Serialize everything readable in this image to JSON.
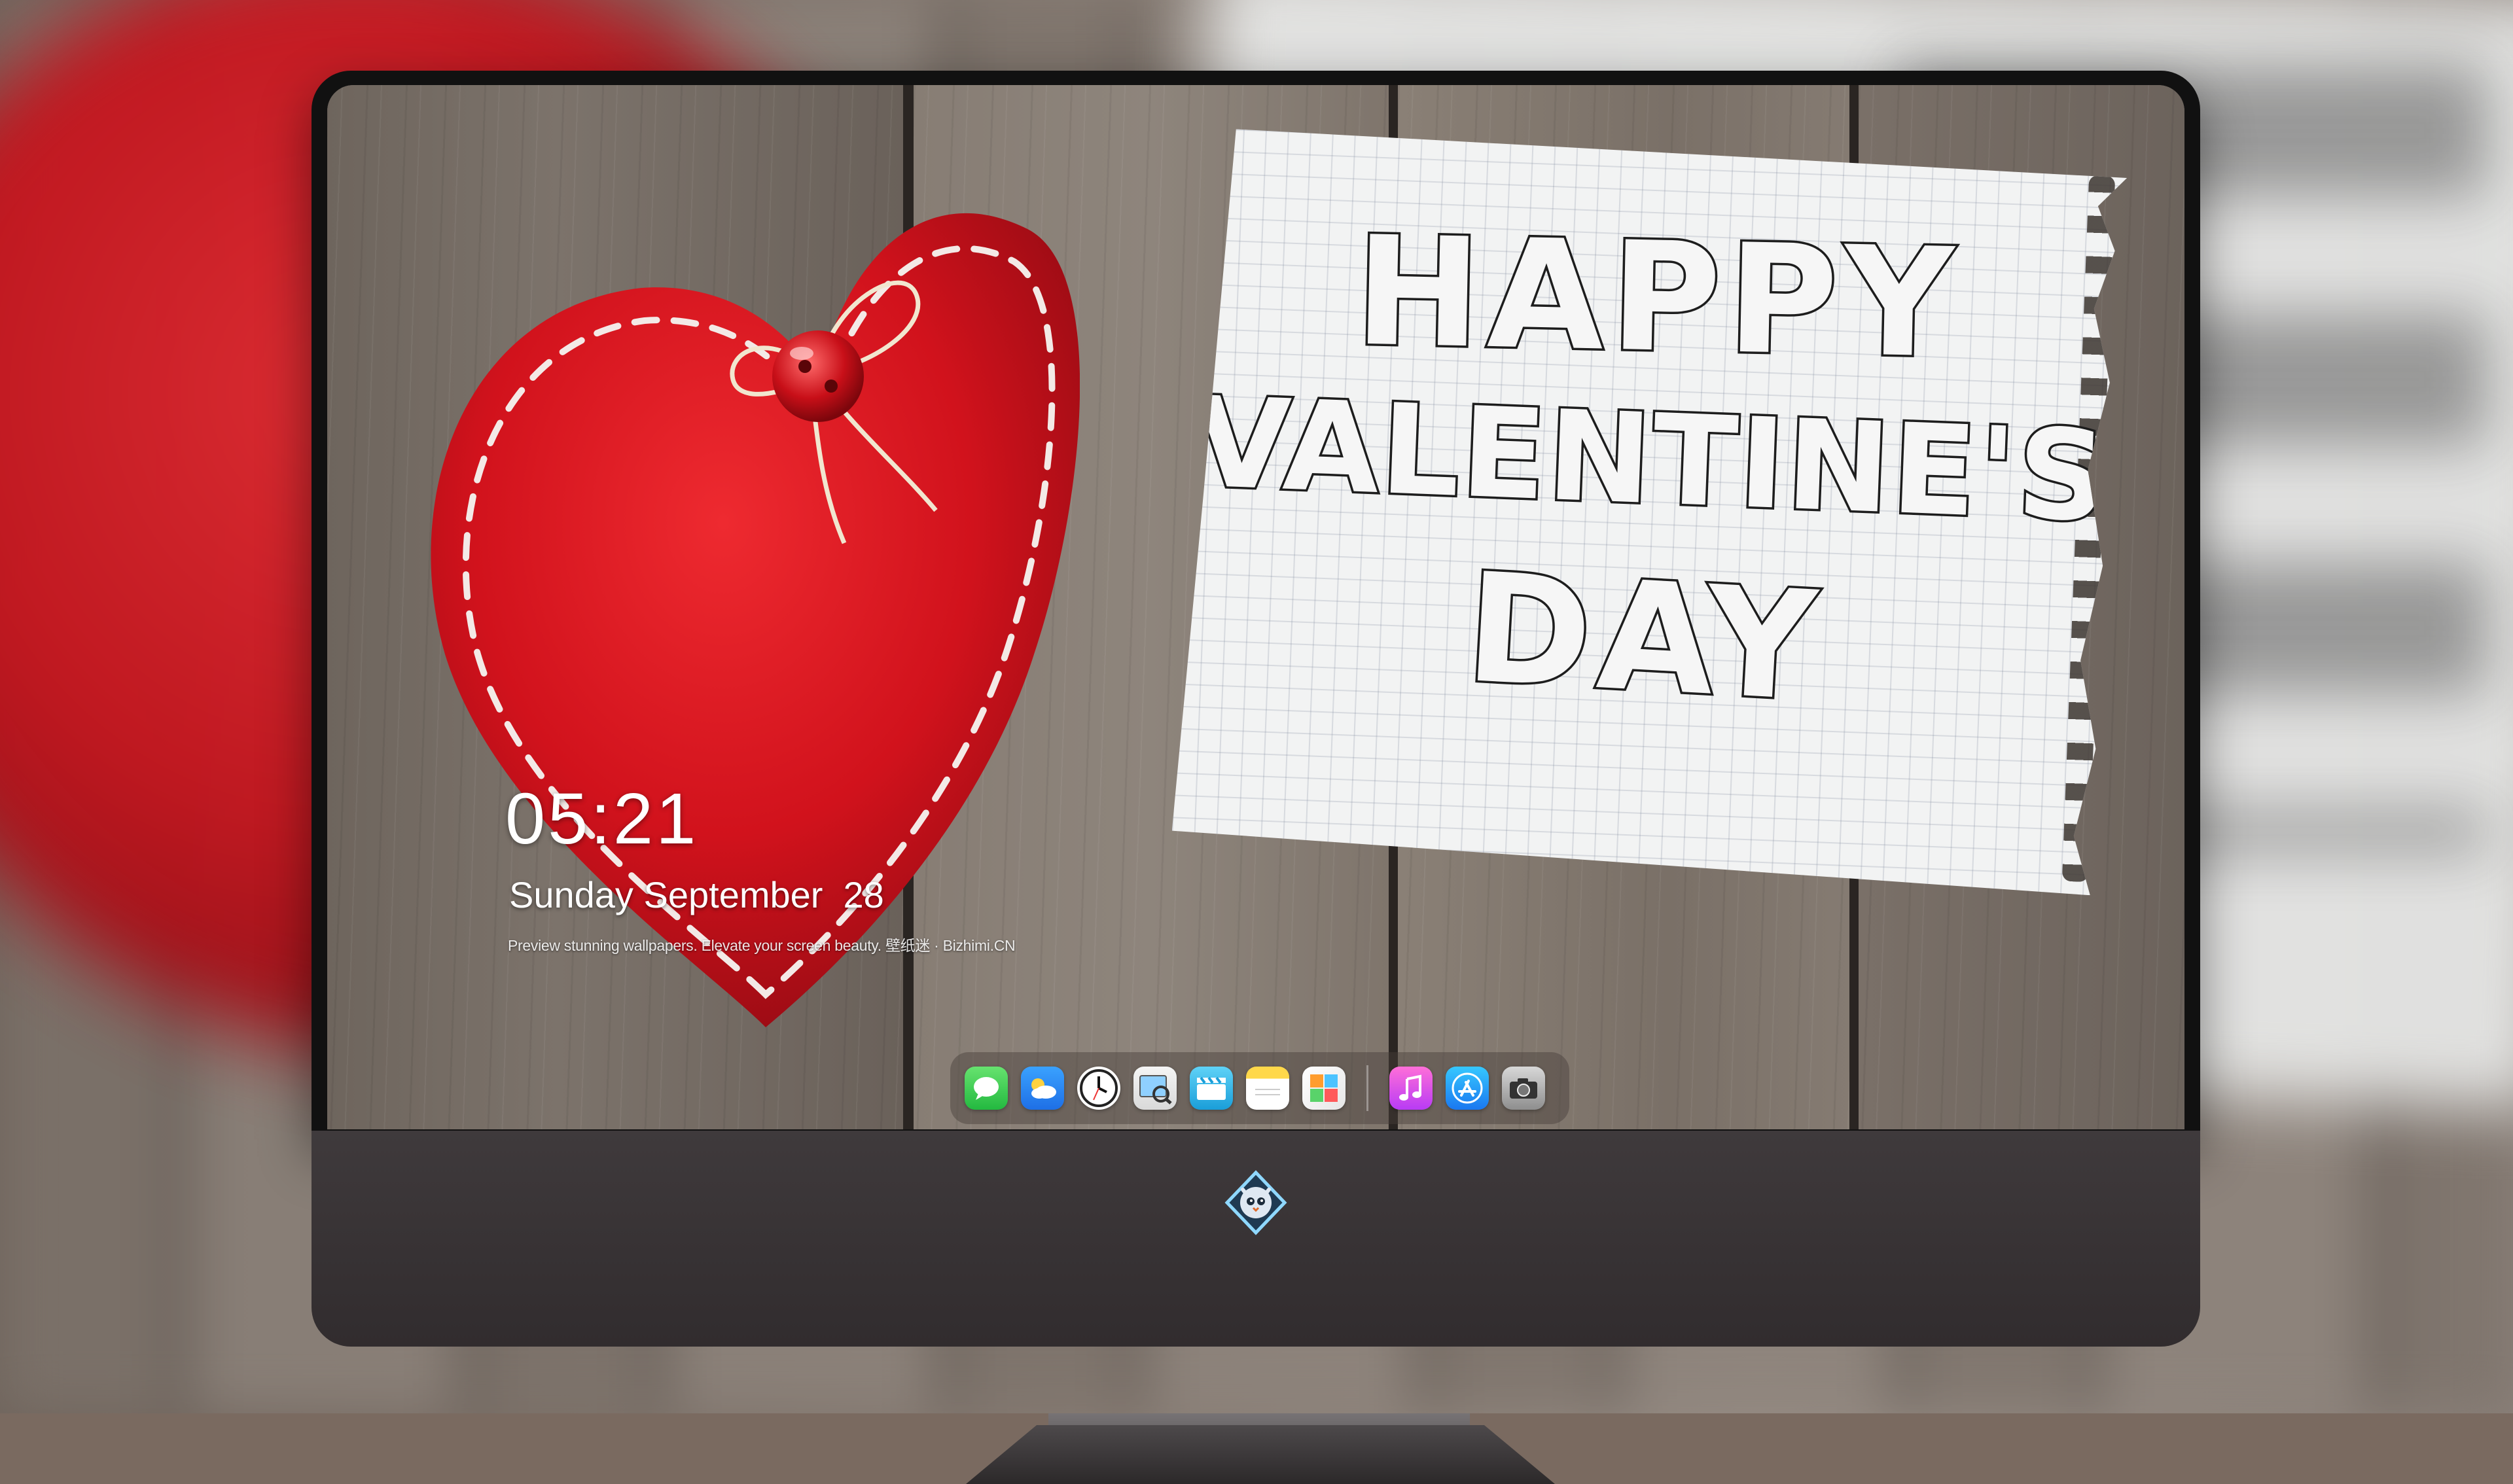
{
  "wallpaper": {
    "note_lines": [
      "HAPPY",
      "VALENTINE'S",
      "DAY"
    ]
  },
  "lockscreen": {
    "time": "05:21",
    "date": "Sunday September  28",
    "tagline": "Preview stunning wallpapers. Elevate your screen beauty. 壁纸迷 · Bizhimi.CN"
  },
  "dock": {
    "apps": [
      {
        "name": "Messages",
        "icon": "messages-icon"
      },
      {
        "name": "Weather",
        "icon": "weather-icon"
      },
      {
        "name": "Clock",
        "icon": "clock-icon"
      },
      {
        "name": "Preview",
        "icon": "preview-icon"
      },
      {
        "name": "Clips",
        "icon": "clips-icon"
      },
      {
        "name": "Notes",
        "icon": "notes-icon"
      },
      {
        "name": "Photos",
        "icon": "photos-icon"
      },
      {
        "name": "Music",
        "icon": "music-icon"
      },
      {
        "name": "App Store",
        "icon": "app-store-icon"
      },
      {
        "name": "Camera",
        "icon": "camera-icon"
      }
    ]
  },
  "brand": {
    "logo_icon": "owl-mascot-logo-icon"
  },
  "colors": {
    "heart_red": "#d8141f",
    "stitch_white": "#f3e9e6",
    "bezel": "#111111",
    "chin": "#3a3537"
  }
}
